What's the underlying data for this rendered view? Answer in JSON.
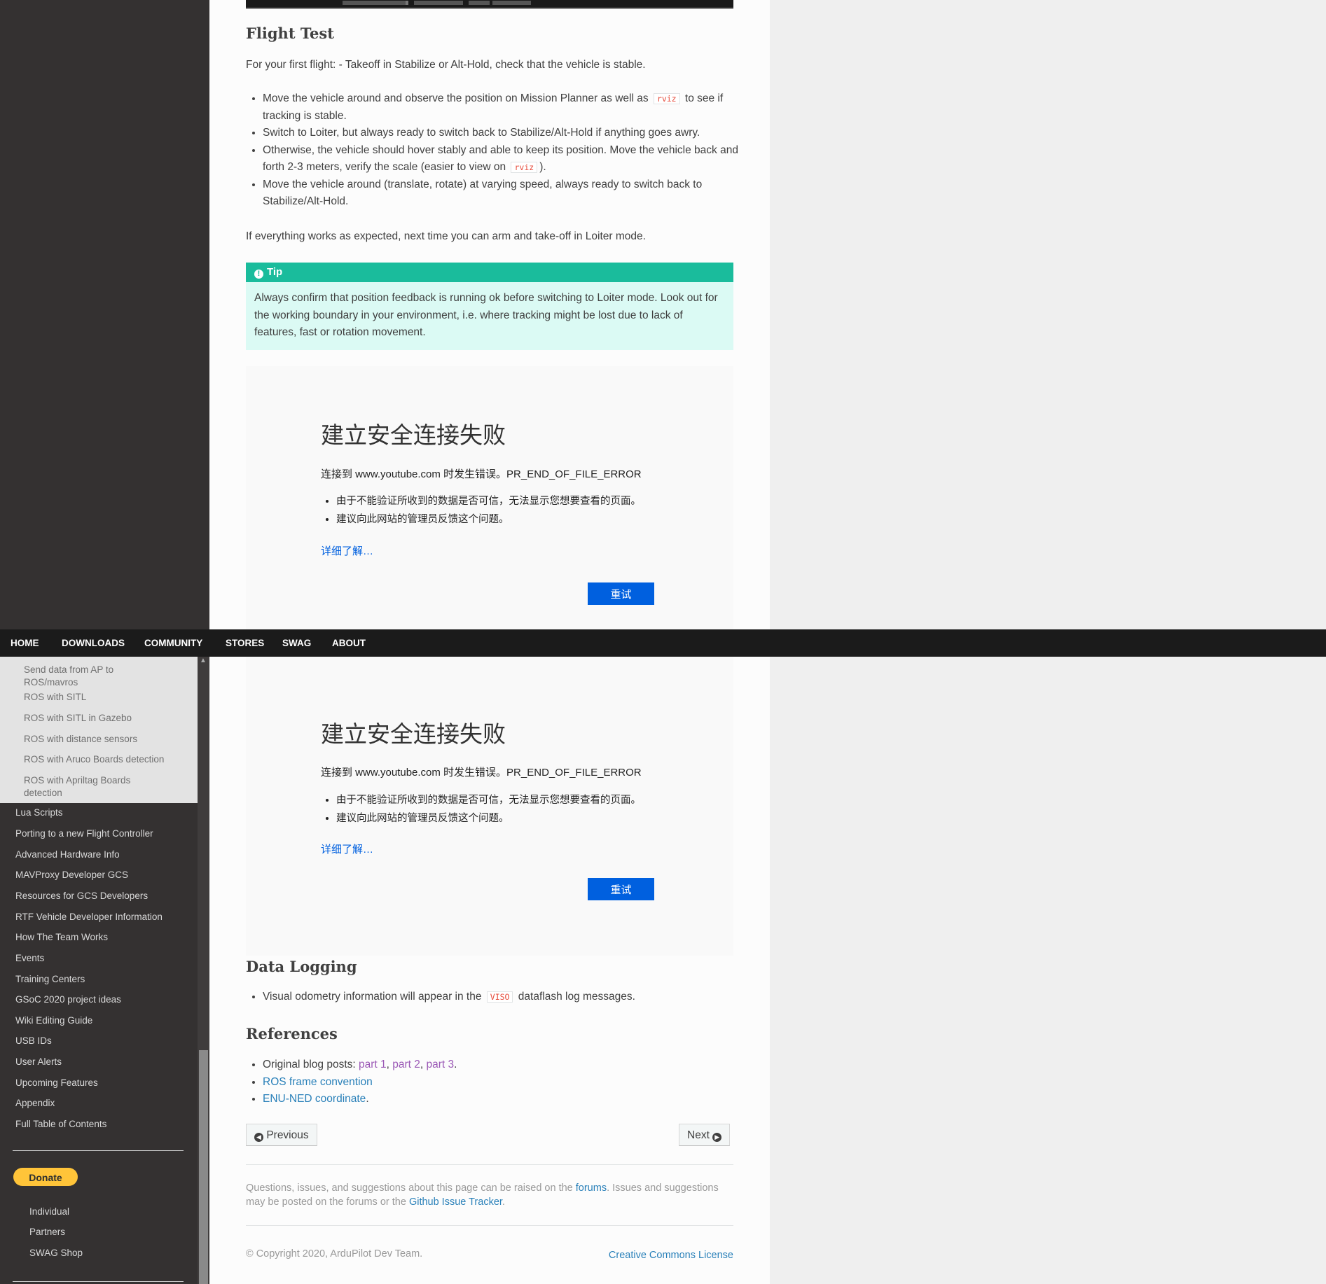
{
  "flight_test": {
    "heading": "Flight Test",
    "intro": "For your first flight: - Takeoff in Stabilize or Alt-Hold, check that the vehicle is stable.",
    "b1_pre": "Move the vehicle around and observe the position on Mission Planner as well as",
    "b1_code": "rviz",
    "b1_post": "to see if tracking is stable.",
    "b2": "Switch to Loiter, but always ready to switch back to Stabilize/Alt-Hold if anything goes awry.",
    "b3_pre": "Otherwise, the vehicle should hover stably and able to keep its position. Move the vehicle back and forth 2-3 meters, verify the scale (easier to view on",
    "b3_code": "rviz",
    "b3_post": ").",
    "b4": "Move the vehicle around (translate, rotate) at varying speed, always ready to switch back to Stabilize/Alt-Hold.",
    "outro": "If everything works as expected, next time you can arm and take-off in Loiter mode."
  },
  "tip": {
    "icon": "info-icon",
    "title": "Tip",
    "body": "Always confirm that position feedback is running ok before switching to Loiter mode. Look out for the working boundary in your environment, i.e. where tracking might be lost due to lack of features, fast or rotation movement."
  },
  "error_panel": {
    "title": "建立安全连接失败",
    "message": "连接到 www.youtube.com 时发生错误。PR_END_OF_FILE_ERROR",
    "bullets": [
      "由于不能验证所收到的数据是否可信，无法显示您想要查看的页面。",
      "建议向此网站的管理员反馈这个问题。"
    ],
    "learn_more": "详细了解…",
    "retry": "重试"
  },
  "nav": {
    "items": [
      "HOME",
      "DOWNLOADS",
      "COMMUNITY",
      "STORES",
      "SWAG",
      "ABOUT"
    ]
  },
  "sidebar": {
    "sub_items": [
      "Send data from AP to ROS/mavros",
      "ROS with SITL",
      "ROS with SITL in Gazebo",
      "ROS with distance sensors",
      "ROS with Aruco Boards detection",
      "ROS with Apriltag Boards detection"
    ],
    "items": [
      "Lua Scripts",
      "Porting to a new Flight Controller",
      "Advanced Hardware Info",
      "MAVProxy Developer GCS",
      "Resources for GCS Developers",
      "RTF Vehicle Developer Information",
      "How The Team Works",
      "Events",
      "Training Centers",
      "GSoC 2020 project ideas",
      "Wiki Editing Guide",
      "USB IDs",
      "User Alerts",
      "Upcoming Features",
      "Appendix",
      "Full Table of Contents"
    ],
    "donate": "Donate",
    "donate_items": [
      "Individual",
      "Partners",
      "SWAG Shop"
    ]
  },
  "data_logging": {
    "heading": "Data Logging",
    "b1_pre": "Visual odometry information will appear in the",
    "b1_code": "VISO",
    "b1_post": "dataflash log messages."
  },
  "references": {
    "heading": "References",
    "blog_pre": "Original blog posts:",
    "part1": "part 1",
    "part2": "part 2",
    "part3": "part 3",
    "sep": ",",
    "end": ".",
    "ros_frame": "ROS frame convention",
    "enu_ned": "ENU-NED coordinate"
  },
  "pager": {
    "previous": "Previous",
    "next": "Next"
  },
  "footer": {
    "q_pre": "Questions, issues, and suggestions about this page can be raised on the",
    "forums": "forums",
    "q_mid": ". Issues and suggestions may be posted on the forums or the",
    "tracker": "Github Issue Tracker",
    "q_end": ".",
    "copyright": "© Copyright 2020, ArduPilot Dev Team.",
    "license": "Creative Commons License"
  }
}
